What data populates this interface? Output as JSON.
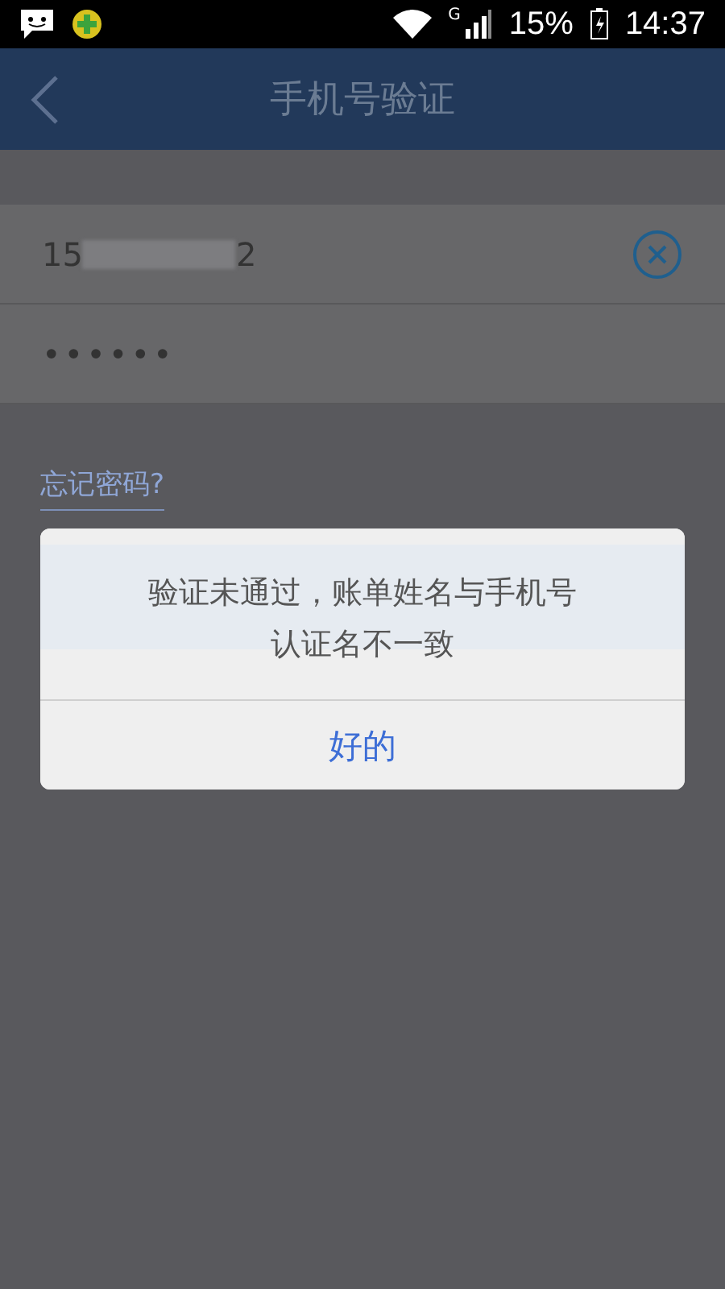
{
  "status_bar": {
    "battery": "15%",
    "time": "14:37",
    "network": "G"
  },
  "app_bar": {
    "title": "手机号验证"
  },
  "form": {
    "phone": {
      "value_start": "15",
      "value_end": "2"
    },
    "password": {
      "value": "••••••"
    },
    "forgot_link": "忘记密码?"
  },
  "dialog": {
    "message": "验证未通过，账单姓名与手机号认证名不一致",
    "buttons": [
      "好的"
    ]
  }
}
